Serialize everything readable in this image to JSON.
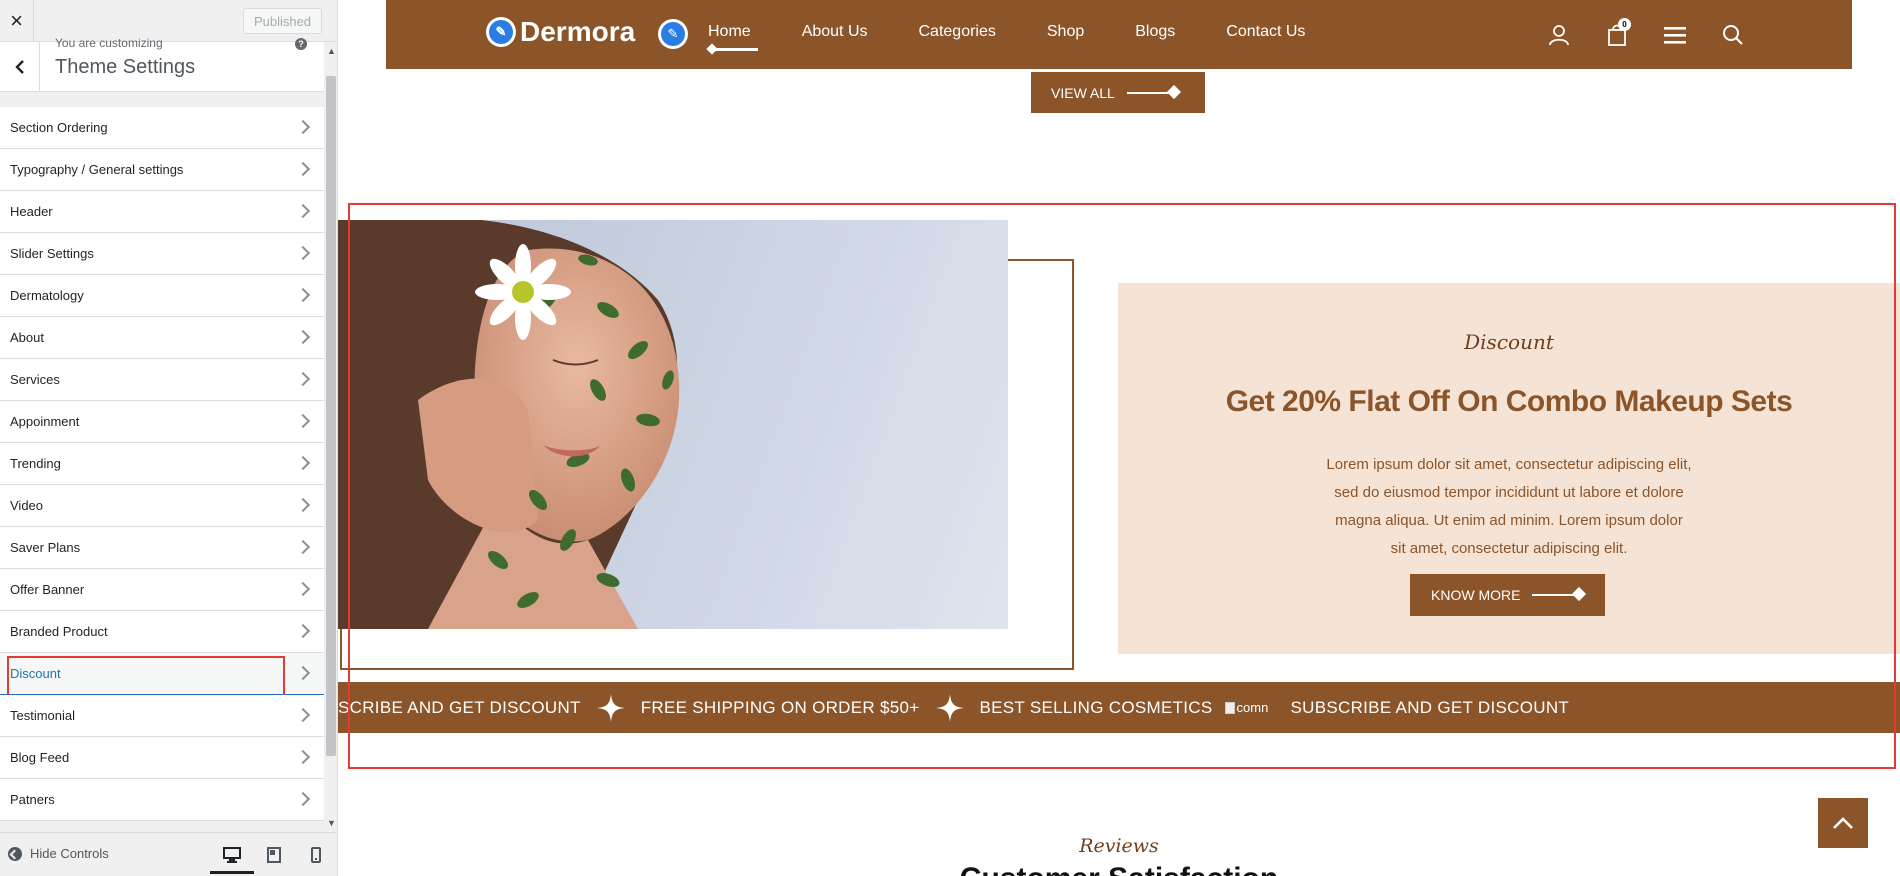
{
  "sidebar": {
    "close_label": "×",
    "publish_label": "Published",
    "customizing_label": "You are customizing",
    "title": "Theme Settings",
    "help_glyph": "?",
    "items": [
      {
        "label": "Section Ordering"
      },
      {
        "label": "Typography / General settings"
      },
      {
        "label": "Header"
      },
      {
        "label": "Slider Settings"
      },
      {
        "label": "Dermatology"
      },
      {
        "label": "About"
      },
      {
        "label": "Services"
      },
      {
        "label": "Appoinment"
      },
      {
        "label": "Trending"
      },
      {
        "label": "Video"
      },
      {
        "label": "Saver Plans"
      },
      {
        "label": "Offer Banner"
      },
      {
        "label": "Branded Product"
      },
      {
        "label": "Discount",
        "active": true
      },
      {
        "label": "Testimonial"
      },
      {
        "label": "Blog Feed"
      },
      {
        "label": "Patners"
      }
    ],
    "hide_controls_label": "Hide Controls"
  },
  "preview": {
    "logo_text": "Dermora",
    "nav": [
      "Home",
      "About Us",
      "Categories",
      "Shop",
      "Blogs",
      "Contact Us"
    ],
    "cart_count": "0",
    "view_all_label": "VIEW ALL",
    "discount": {
      "tag": "Discount",
      "heading": "Get 20% Flat Off On Combo Makeup Sets",
      "body": "Lorem ipsum dolor sit amet, consectetur adipiscing elit, sed do eiusmod tempor incididunt ut labore et dolore magna aliqua. Ut enim ad minim. Lorem ipsum dolor sit amet, consectetur adipiscing elit.",
      "button_label": "KNOW MORE"
    },
    "marquee": [
      "SCRIBE AND GET DISCOUNT",
      "FREE SHIPPING ON ORDER $50+",
      "BEST SELLING COSMETICS",
      "SUBSCRIBE AND GET DISCOUNT"
    ],
    "marquee_broken_alt": "comn",
    "reviews_tag": "Reviews",
    "section_heading": "Customer Satisfaction"
  },
  "colors": {
    "brand_brown": "#8b5429",
    "card_bg": "#f5e4d6",
    "highlight_red": "#e53935",
    "wp_blue": "#2271b1"
  }
}
